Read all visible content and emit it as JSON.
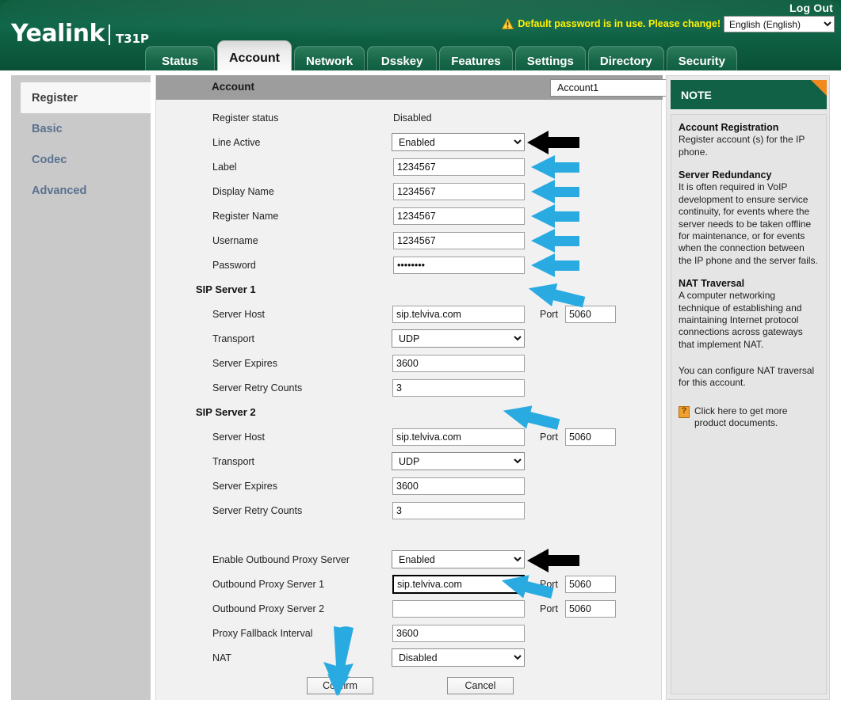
{
  "header": {
    "logout_label": "Log Out",
    "warning_text": "Default password is in use. Please change!",
    "warning_icon": "warning-triangle-icon",
    "language_selected": "English (English)",
    "brand": "Yealink",
    "model": "T31P"
  },
  "tabs": [
    {
      "label": "Status",
      "active": false
    },
    {
      "label": "Account",
      "active": true
    },
    {
      "label": "Network",
      "active": false
    },
    {
      "label": "Dsskey",
      "active": false
    },
    {
      "label": "Features",
      "active": false
    },
    {
      "label": "Settings",
      "active": false
    },
    {
      "label": "Directory",
      "active": false
    },
    {
      "label": "Security",
      "active": false
    }
  ],
  "sidebar": {
    "items": [
      {
        "label": "Register",
        "active": true
      },
      {
        "label": "Basic",
        "active": false
      },
      {
        "label": "Codec",
        "active": false
      },
      {
        "label": "Advanced",
        "active": false
      }
    ]
  },
  "form": {
    "account_bar_label": "Account",
    "account_selected": "Account1",
    "register_status_label": "Register status",
    "register_status_value": "Disabled",
    "line_active_label": "Line Active",
    "line_active_value": "Enabled",
    "label_label": "Label",
    "label_value": "1234567",
    "display_name_label": "Display Name",
    "display_name_value": "1234567",
    "register_name_label": "Register Name",
    "register_name_value": "1234567",
    "username_label": "Username",
    "username_value": "1234567",
    "password_label": "Password",
    "password_value": "••••••••",
    "sip1_heading": "SIP Server 1",
    "sip1_host_label": "Server Host",
    "sip1_host_value": "sip.telviva.com",
    "sip1_port_label": "Port",
    "sip1_port_value": "5060",
    "sip1_transport_label": "Transport",
    "sip1_transport_value": "UDP",
    "sip1_expires_label": "Server Expires",
    "sip1_expires_value": "3600",
    "sip1_retry_label": "Server Retry Counts",
    "sip1_retry_value": "3",
    "sip2_heading": "SIP Server 2",
    "sip2_host_label": "Server Host",
    "sip2_host_value": "sip.telviva.com",
    "sip2_port_label": "Port",
    "sip2_port_value": "5060",
    "sip2_transport_label": "Transport",
    "sip2_transport_value": "UDP",
    "sip2_expires_label": "Server Expires",
    "sip2_expires_value": "3600",
    "sip2_retry_label": "Server Retry Counts",
    "sip2_retry_value": "3",
    "enable_outbound_label": "Enable Outbound Proxy Server",
    "enable_outbound_value": "Enabled",
    "outbound1_label": "Outbound Proxy Server 1",
    "outbound1_value": "sip.telviva.com",
    "outbound1_port_label": "Port",
    "outbound1_port_value": "5060",
    "outbound2_label": "Outbound Proxy Server 2",
    "outbound2_value": "",
    "outbound2_port_label": "Port",
    "outbound2_port_value": "5060",
    "fallback_label": "Proxy Fallback Interval",
    "fallback_value": "3600",
    "nat_label": "NAT",
    "nat_value": "Disabled",
    "confirm_label": "Confirm",
    "cancel_label": "Cancel"
  },
  "note": {
    "title": "NOTE",
    "sections": [
      {
        "heading": "Account Registration",
        "text": "Register account (s) for the IP phone."
      },
      {
        "heading": "Server Redundancy",
        "text": "It is often required in VoIP development to ensure service continuity, for events where the server needs to be taken offline for maintenance, or for events when the connection between the IP phone and the server fails."
      },
      {
        "heading": "NAT Traversal",
        "text": "A computer networking technique of establishing and maintaining Internet protocol connections across gateways that implement NAT."
      }
    ],
    "extra_text": "You can configure NAT traversal for this account.",
    "link_text": "Click here to get more product documents.",
    "link_icon": "document-help-icon"
  },
  "annotations": {
    "black_arrow_color": "#000000",
    "blue_arrow_color": "#29ABE2",
    "count_black": 2,
    "count_blue": 9
  }
}
